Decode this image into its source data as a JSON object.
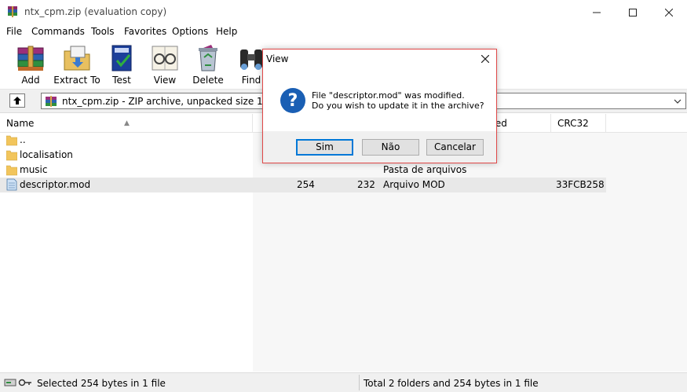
{
  "window": {
    "title": "ntx_cpm.zip (evaluation copy)",
    "minimize_glyph": "–",
    "maximize_glyph": "□",
    "close_glyph": "✕"
  },
  "menu": [
    "File",
    "Commands",
    "Tools",
    "Favorites",
    "Options",
    "Help"
  ],
  "toolbar": {
    "buttons": [
      {
        "label": "Add",
        "icon": "books-add-icon"
      },
      {
        "label": "Extract To",
        "icon": "folder-extract-icon"
      },
      {
        "label": "Test",
        "icon": "book-test-icon"
      },
      {
        "label": "View",
        "icon": "glasses-view-icon"
      },
      {
        "label": "Delete",
        "icon": "recycle-delete-icon"
      },
      {
        "label": "Find",
        "icon": "binoculars-find-icon"
      }
    ]
  },
  "address": {
    "text": "ntx_cpm.zip - ZIP archive, unpacked size 140.129.",
    "up_icon": "up-arrow-icon",
    "dropdown_icon": "chevron-down-icon"
  },
  "columns": {
    "name": "Name",
    "modified": "ified",
    "crc": "CRC32"
  },
  "files": [
    {
      "name": "..",
      "size": "",
      "packed": "",
      "type": "",
      "crc": "",
      "icon": "folder-icon"
    },
    {
      "name": "localisation",
      "size": "",
      "packed": "",
      "type": "",
      "crc": "",
      "icon": "folder-icon"
    },
    {
      "name": "music",
      "size": "",
      "packed": "",
      "type": "Pasta de arquivos",
      "crc": "",
      "icon": "folder-icon"
    },
    {
      "name": "descriptor.mod",
      "size": "254",
      "packed": "232",
      "type": "Arquivo MOD",
      "crc": "33FCB258",
      "icon": "file-icon"
    }
  ],
  "status": {
    "left": "Selected 254 bytes in 1 file",
    "right": "Total 2 folders and 254 bytes in 1 file"
  },
  "dialog": {
    "title": "View",
    "line1": "File \"descriptor.mod\" was modified.",
    "line2": "Do you wish to update it in the archive?",
    "question_glyph": "?",
    "yes": "Sim",
    "no": "Não",
    "cancel": "Cancelar",
    "close_glyph": "✕"
  },
  "colors": {
    "accent": "#0078d7",
    "dialog_border": "#e04848",
    "question_icon": "#1a5fb4",
    "folder": "#f2c55c"
  }
}
